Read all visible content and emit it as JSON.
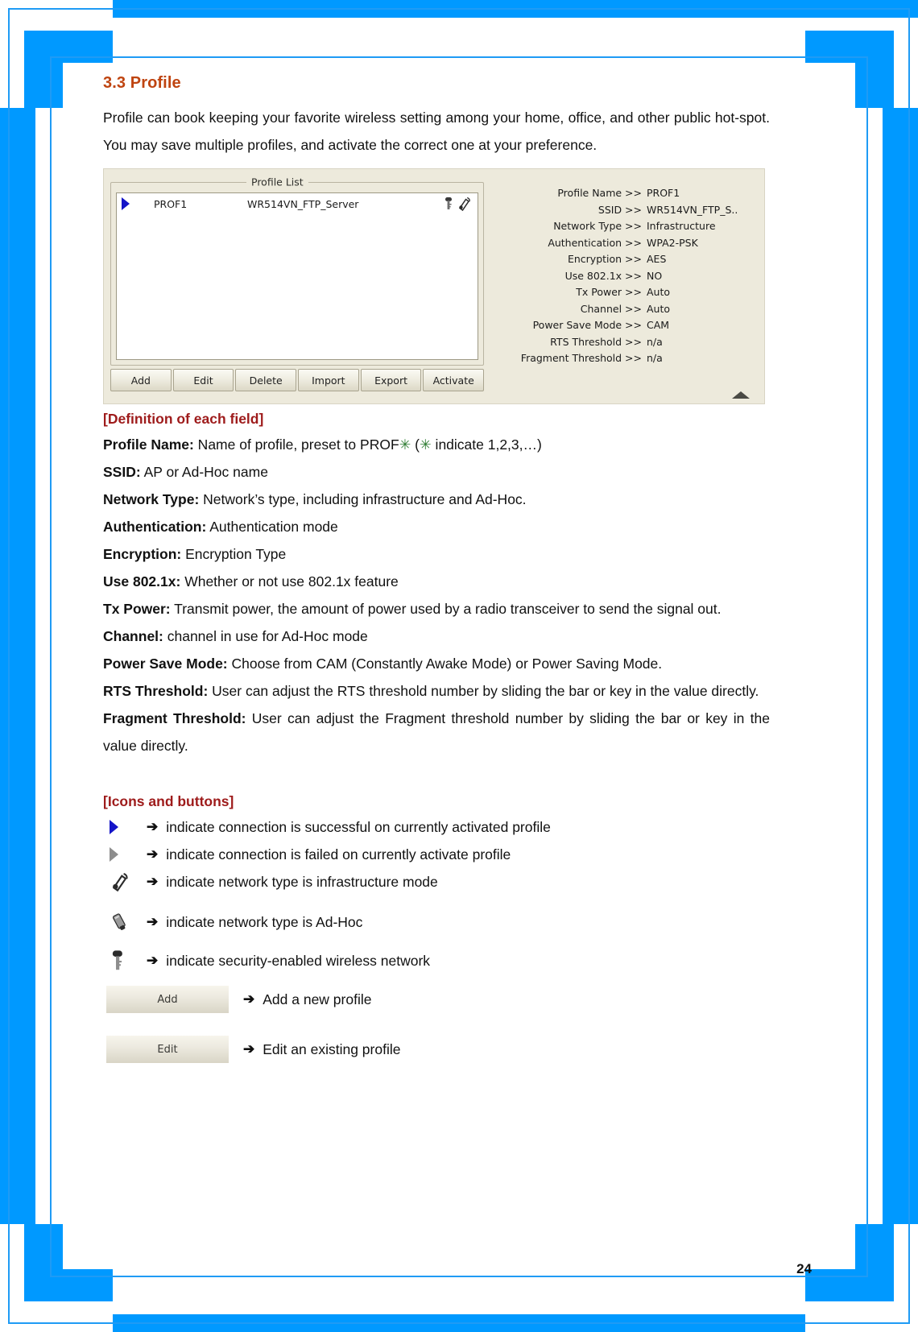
{
  "document": {
    "page_number": "24",
    "accent_heading_color": "#BF4410",
    "block_heading_color": "#9E1B1B",
    "frame_color": "#0099FF"
  },
  "section": {
    "heading": "3.3 Profile",
    "intro": "Profile can book keeping your favorite wireless setting among your home, office, and other public hot-spot. You may save multiple profiles, and activate the correct one at your preference."
  },
  "screenshot": {
    "profile_list_title": "Profile List",
    "row": {
      "profile_name": "PROF1",
      "ssid": "WR514VN_FTP_Server",
      "status_icon": "active-arrow-icon",
      "security_icon": "key-icon",
      "network_icon": "infrastructure-icon"
    },
    "buttons": [
      "Add",
      "Edit",
      "Delete",
      "Import",
      "Export",
      "Activate"
    ],
    "details": [
      {
        "label": "Profile Name >>",
        "value": "PROF1"
      },
      {
        "label": "SSID >>",
        "value": "WR514VN_FTP_S.."
      },
      {
        "label": "Network Type >>",
        "value": "Infrastructure"
      },
      {
        "label": "Authentication >>",
        "value": "WPA2-PSK"
      },
      {
        "label": "Encryption >>",
        "value": "AES"
      },
      {
        "label": "Use 802.1x >>",
        "value": "NO"
      },
      {
        "label": "Tx Power >>",
        "value": "Auto"
      },
      {
        "label": "Channel >>",
        "value": "Auto"
      },
      {
        "label": "Power Save Mode >>",
        "value": "CAM"
      },
      {
        "label": "RTS Threshold >>",
        "value": "n/a"
      },
      {
        "label": "Fragment Threshold >>",
        "value": "n/a"
      }
    ]
  },
  "definitions": {
    "heading": "[Definition of each field]",
    "items": [
      {
        "term": "Profile Name:",
        "desc_pre": " Name of profile, preset to PROF",
        "asterisk1": "✳",
        "desc_mid": "  (",
        "asterisk2": "✳",
        "desc_post": "  indicate 1,2,3,…)"
      },
      {
        "term": "SSID:",
        "desc": " AP or Ad-Hoc name"
      },
      {
        "term": "Network Type:",
        "desc": " Network’s type, including infrastructure and Ad-Hoc."
      },
      {
        "term": "Authentication:",
        "desc": " Authentication mode"
      },
      {
        "term": "Encryption:",
        "desc": " Encryption Type"
      },
      {
        "term": "Use 802.1x:",
        "desc": " Whether or not use 802.1x feature"
      },
      {
        "term": "Tx Power:",
        "desc": " Transmit power, the amount of power used by a radio transceiver to send the signal out."
      },
      {
        "term": "Channel:",
        "desc": " channel in use for Ad-Hoc mode"
      },
      {
        "term": "Power Save Mode:",
        "desc": " Choose from CAM (Constantly Awake Mode) or Power Saving Mode."
      },
      {
        "term": "RTS Threshold:",
        "desc": " User can adjust the RTS threshold number by sliding the bar or key in the value directly."
      },
      {
        "term": "Fragment Threshold:",
        "desc": " User can adjust the Fragment threshold number by sliding the bar or key in the value directly."
      }
    ]
  },
  "icons_and_buttons": {
    "heading": "[Icons and buttons]",
    "arrow_glyph": "➔",
    "rows": [
      {
        "icon": "active-arrow-icon",
        "desc": "indicate connection is successful on currently activated profile"
      },
      {
        "icon": "inactive-arrow-icon",
        "desc": "indicate connection is failed on currently activate profile"
      },
      {
        "icon": "infrastructure-icon",
        "desc": "indicate network type is infrastructure mode"
      },
      {
        "icon": "adhoc-icon",
        "desc": "indicate network type is Ad-Hoc"
      },
      {
        "icon": "key-icon",
        "desc": "indicate security-enabled wireless network"
      }
    ],
    "button_rows": [
      {
        "label": "Add",
        "desc": "Add a new profile"
      },
      {
        "label": "Edit",
        "desc": "Edit an existing profile"
      }
    ]
  }
}
